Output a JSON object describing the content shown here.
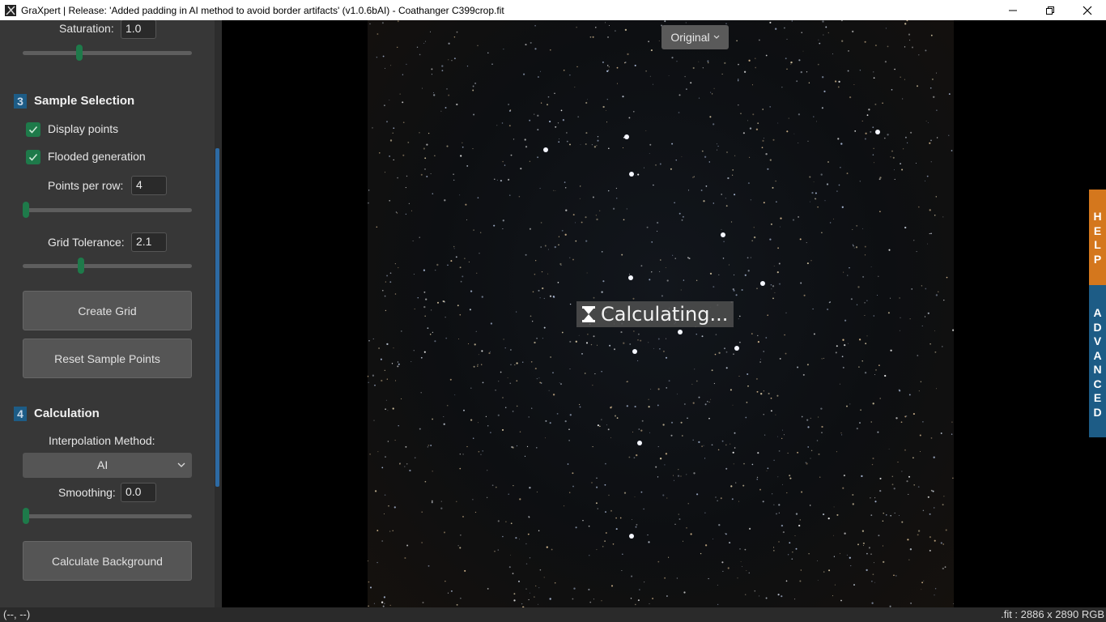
{
  "window": {
    "title": "GraXpert | Release: 'Added padding in AI method to avoid border artifacts' (v1.0.6bAI) - Coathanger C399crop.fit"
  },
  "sidebar": {
    "saturation": {
      "label": "Saturation:",
      "value": "1.0",
      "slider_fraction": 0.33
    },
    "section3": {
      "number": "3",
      "title": "Sample Selection"
    },
    "display_points": {
      "label": "Display points",
      "checked": true
    },
    "flooded_generation": {
      "label": "Flooded generation",
      "checked": true
    },
    "points_per_row": {
      "label": "Points per row:",
      "value": "4",
      "slider_fraction": 0.0
    },
    "grid_tolerance": {
      "label": "Grid Tolerance:",
      "value": "2.1",
      "slider_fraction": 0.35
    },
    "create_grid": "Create Grid",
    "reset_sample_points": "Reset Sample Points",
    "section4": {
      "number": "4",
      "title": "Calculation"
    },
    "interpolation_label": "Interpolation Method:",
    "interpolation_value": "AI",
    "smoothing": {
      "label": "Smoothing:",
      "value": "0.0",
      "slider_fraction": 0.0
    },
    "calculate_background": "Calculate Background"
  },
  "canvas": {
    "view_select": "Original",
    "status_overlay": "Calculating..."
  },
  "right_tabs": {
    "help": "HELP",
    "advanced": "ADVANCED"
  },
  "statusbar": {
    "coords": "(--, --)",
    "file_info": ".fit : 2886 x 2890 RGB"
  },
  "colors": {
    "accent_green": "#1e7a4a",
    "accent_blue": "#1d5c86",
    "help_orange": "#d4771d"
  }
}
